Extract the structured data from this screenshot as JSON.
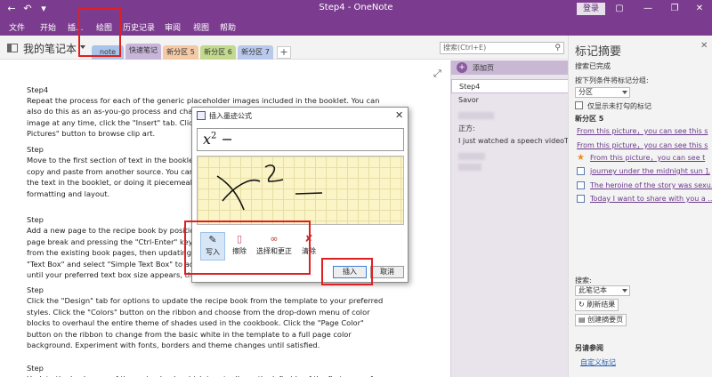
{
  "window": {
    "title": "Step4  -  OneNote",
    "login_label": "登录"
  },
  "menu": {
    "items": [
      "文件",
      "开始",
      "插...",
      "绘图",
      "历史记录",
      "审阅",
      "视图",
      "帮助"
    ]
  },
  "notebook": {
    "name": "我的笔记本",
    "tabs": [
      {
        "label": "note",
        "color": "#a9c4e8"
      },
      {
        "label": "快速笔记",
        "color": "#c7b6d9"
      },
      {
        "label": "新分区 5",
        "color": "#f3c9a6"
      },
      {
        "label": "新分区 6",
        "color": "#c2d98e"
      },
      {
        "label": "新分区 7",
        "color": "#b9c9eb"
      }
    ],
    "add_tab_label": "+",
    "search_placeholder": "搜索(Ctrl+E)"
  },
  "page": {
    "paragraphs": [
      {
        "lines": [
          "Step4"
        ]
      },
      {
        "lines": [
          "Repeat the process for each of the generic placeholder images included in the booklet. You can",
          "also do this as an as-you-go process and change the",
          "image at any time, click the \"Insert\" tab. Click eith",
          "Pictures\" button to browse clip art."
        ]
      },
      {
        "lines": [
          "Step",
          "Move to the first section of text in the booklet. Hig",
          "copy and paste from another source. You can do t",
          "the text in the booklet, or doing it piecemeal. Add",
          "formatting and layout."
        ]
      },
      {
        "lines": [
          "Step",
          "Add a new page to the recipe book by positioning",
          "page break and pressing the \"Ctrl-Enter\" keys. Ado",
          "from the existing book pages, then updating the m",
          "\"Text Box\" and select \"Simple Text Box\" to add a n",
          "until your preferred text box size appears, then cli"
        ]
      },
      {
        "lines": [
          "Step",
          "Click the \"Design\" tab for options to update the recipe book from the template to your preferred",
          "styles. Click the \"Colors\" button on the ribbon and choose from the drop-down menu of color",
          "blocks to overhaul the entire theme of shades used in the cookbook. Click the \"Page Color\"",
          "button on the ribbon to change from the basic white in the template to a full page color",
          "background. Experiment with fonts, borders and theme changes until satisfied."
        ]
      },
      {
        "lines": [
          "Step",
          "Update the back page of the recipe book, which is actually on the left side of the first page of"
        ]
      }
    ]
  },
  "pagelist": {
    "add_page_label": "添加页",
    "pages": [
      "Step4",
      "Savor",
      "",
      "正方:",
      "I just watched a speech videoTh",
      ""
    ]
  },
  "dialog": {
    "title": "插入墨迹公式",
    "preview_base": "x",
    "preview_sup": "2",
    "preview_rest": " −",
    "tools": [
      {
        "label": "写入",
        "icon": "pen-icon"
      },
      {
        "label": "擦除",
        "icon": "eraser-icon"
      },
      {
        "label": "选择和更正",
        "icon": "lasso-icon"
      },
      {
        "label": "清除",
        "icon": "clear-icon"
      }
    ],
    "insert_label": "插入",
    "cancel_label": "取消"
  },
  "tags_panel": {
    "title": "标记摘要",
    "status": "搜索已完成",
    "group_label": "按下列条件将标记分组:",
    "group_value": "分区",
    "unchecked_only_label": "仅显示未打勾的标记",
    "section_name": "新分区 5",
    "items": [
      {
        "text": "From this picture，you can see this s",
        "marker": "none"
      },
      {
        "text": "From this picture，you can see this s",
        "marker": "none"
      },
      {
        "text": "From this picture，you can see t",
        "marker": "star"
      },
      {
        "text": "journey under the midnight sun ],",
        "marker": "checkbox"
      },
      {
        "text": "The heroine of the story was sexu...",
        "marker": "checkbox"
      },
      {
        "text": "Today I want to share with you a ...",
        "marker": "checkbox"
      }
    ],
    "search_label": "搜索:",
    "search_scope": "此笔记本",
    "refresh_label": "刷新结果",
    "create_summary_label": "创建摘要页",
    "see_also_label": "另请参阅",
    "custom_tags_label": "自定义标记",
    "star_color": "#f08a1c",
    "link_color": "#6a3a8a"
  },
  "colors": {
    "title_bar": "#7b3c8f",
    "highlight": "#e02020",
    "canvas": "#fbf4c6"
  }
}
